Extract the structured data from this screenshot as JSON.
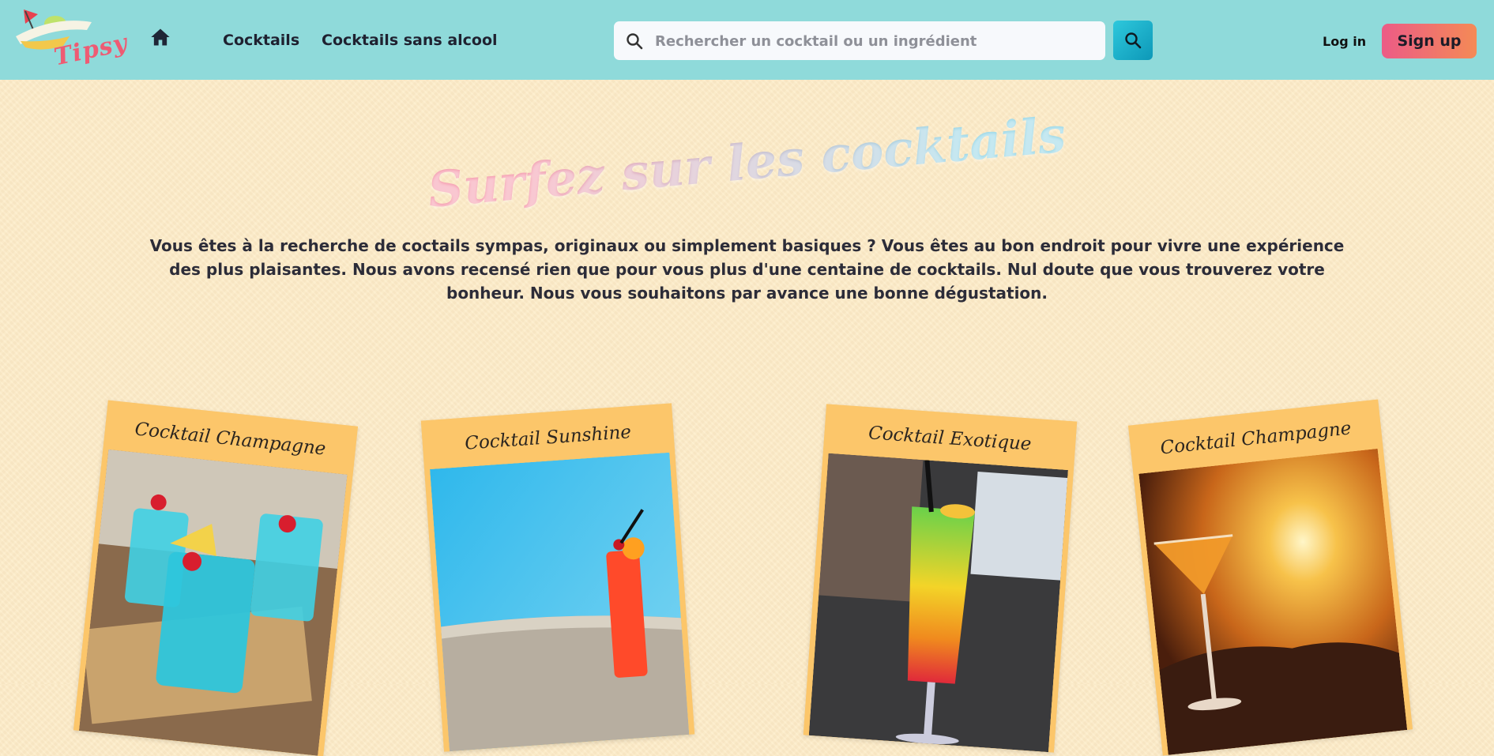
{
  "header": {
    "logo_text": "Tipsy",
    "nav": [
      {
        "label": "Cocktails"
      },
      {
        "label": "Cocktails sans alcool"
      }
    ],
    "search": {
      "placeholder": "Rechercher un cocktail ou un ingrédient"
    },
    "login_label": "Log in",
    "signup_label": "Sign up"
  },
  "hero": {
    "title": "Surfez sur les cocktails",
    "description": "Vous êtes à la recherche de coctails sympas, originaux ou simplement basiques ? Vous êtes au bon endroit pour vivre une expérience des plus plaisantes. Nous avons recensé rien que pour vous plus d'une centaine de cocktails. Nul doute que vous trouverez votre bonheur. Nous vous souhaitons par avance une bonne dégustation."
  },
  "cards": [
    {
      "title": "Cocktail Champagne",
      "image": "blue-lagoon-glasses-photo"
    },
    {
      "title": "Cocktail Sunshine",
      "image": "orange-drink-by-pool-photo"
    },
    {
      "title": "Cocktail Exotique",
      "image": "rainbow-layered-cocktail-photo"
    },
    {
      "title": "Cocktail Champagne",
      "image": "martini-at-sunset-photo"
    }
  ],
  "colors": {
    "header_bg": "#8fdada",
    "page_bg": "#fdebc6",
    "card_bg": "#fcc66a",
    "search_button": "#1aaec8",
    "signup_gradient": [
      "#ec5b86",
      "#f48a56"
    ]
  }
}
